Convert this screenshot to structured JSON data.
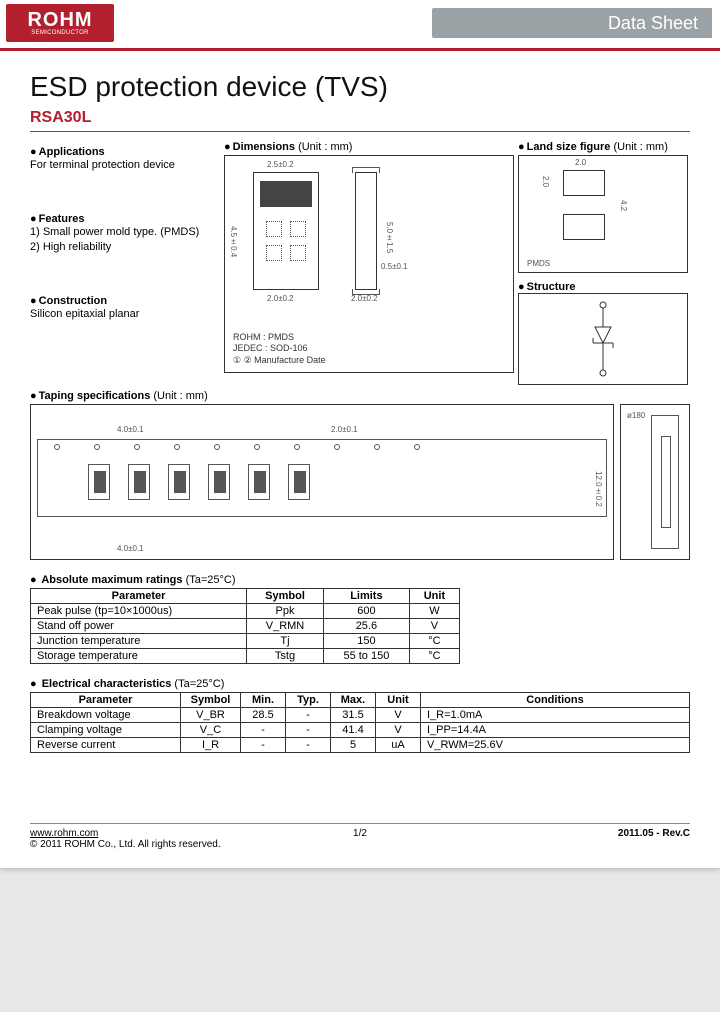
{
  "header": {
    "logo_main": "ROHM",
    "logo_sub": "SEMICONDUCTOR",
    "datasheet_label": "Data Sheet"
  },
  "title": "ESD protection device (TVS)",
  "part_number": "RSA30L",
  "sections": {
    "applications": {
      "label": "Applications",
      "text": "For terminal protection device"
    },
    "features": {
      "label": "Features",
      "items": [
        "1) Small power mold type. (PMDS)",
        "2) High reliability"
      ]
    },
    "construction": {
      "label": "Construction",
      "text": "Silicon epitaxial planar"
    },
    "dimensions": {
      "label": "Dimensions",
      "unit": "(Unit : mm)",
      "package_name": "ROHM : PMDS",
      "jedec": "JEDEC : SOD-106",
      "marking_legend": "① ② Manufacture Date",
      "body_w": "2.5±0.2",
      "body_h": "4.5±0.4",
      "lead_w": "2.0±0.2",
      "lead_h": "0.5±0.1",
      "thickness": "2.0±0.2",
      "overall_h": "5.0±1.5"
    },
    "land": {
      "label": "Land size figure",
      "unit": "(Unit : mm)",
      "pad_w": "2.0",
      "pad_h": "2.0",
      "pitch": "4.2",
      "pkg": "PMDS"
    },
    "structure": {
      "label": "Structure"
    },
    "taping": {
      "label": "Taping specifications",
      "unit": "(Unit : mm)",
      "pitch": "4.0±0.1",
      "width": "12.0±0.2",
      "sprocket_pitch": "2.0±0.1",
      "reel": "ø180"
    }
  },
  "abs_max": {
    "title": "Absolute maximum ratings",
    "cond": "(Ta=25°C)",
    "headers": [
      "Parameter",
      "Symbol",
      "Limits",
      "Unit"
    ],
    "rows": [
      [
        "Peak pulse (tp=10×1000us)",
        "Ppk",
        "600",
        "W"
      ],
      [
        "Stand off power",
        "V_RMN",
        "25.6",
        "V"
      ],
      [
        "Junction temperature",
        "Tj",
        "150",
        "°C"
      ],
      [
        "Storage temperature",
        "Tstg",
        "55 to 150",
        "°C"
      ]
    ]
  },
  "elec": {
    "title": "Electrical characteristics",
    "cond": "(Ta=25°C)",
    "headers": [
      "Parameter",
      "Symbol",
      "Min.",
      "Typ.",
      "Max.",
      "Unit",
      "Conditions"
    ],
    "rows": [
      [
        "Breakdown voltage",
        "V_BR",
        "28.5",
        "-",
        "31.5",
        "V",
        "I_R=1.0mA"
      ],
      [
        "Clamping voltage",
        "V_C",
        "-",
        "-",
        "41.4",
        "V",
        "I_PP=14.4A"
      ],
      [
        "Reverse current",
        "I_R",
        "-",
        "-",
        "5",
        "uA",
        "V_RWM=25.6V"
      ]
    ]
  },
  "footer": {
    "url": "www.rohm.com",
    "copyright": "© 2011 ROHM Co., Ltd. All rights reserved.",
    "page": "1/2",
    "rev": "2011.05 - Rev.C"
  }
}
